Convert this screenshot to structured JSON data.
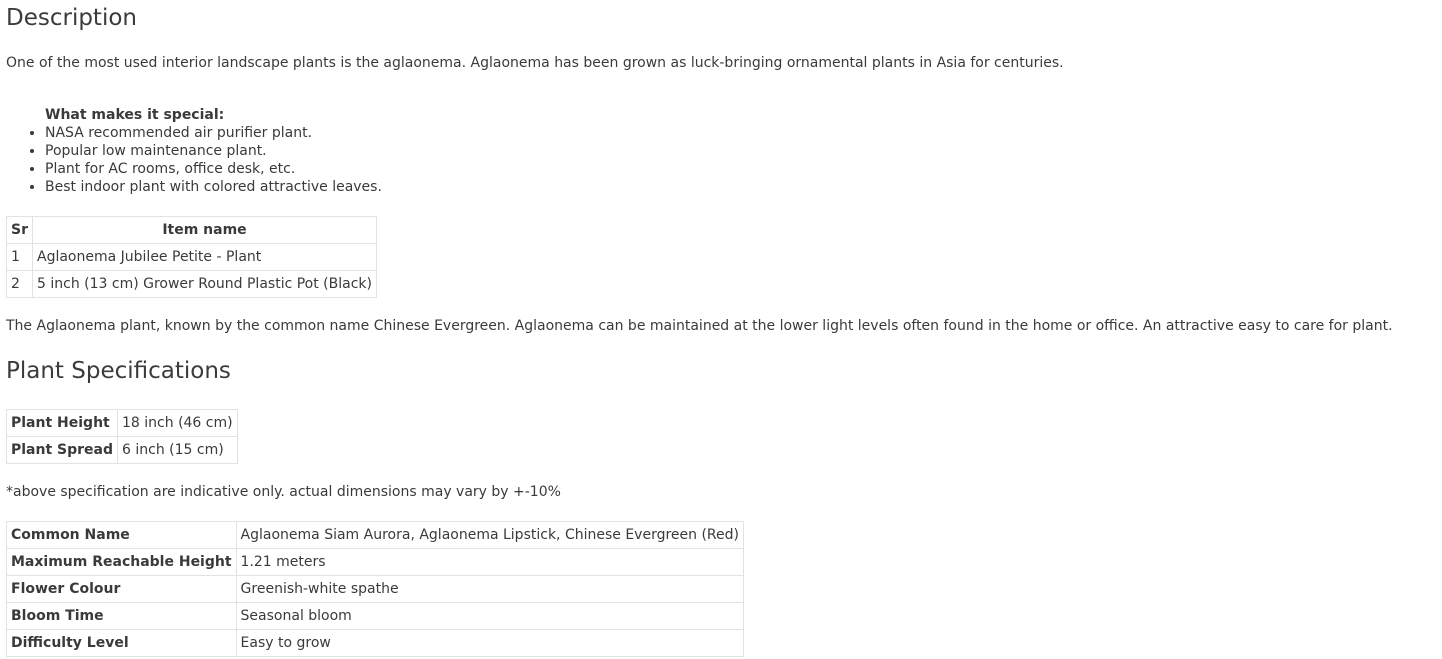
{
  "description": {
    "heading": "Description",
    "intro": "One of the most used interior landscape plants is the aglaonema. Aglaonema has been grown as luck-bringing ornamental plants in Asia for centuries.",
    "special_title": "What makes it special:",
    "features": [
      "NASA recommended air purifier plant.",
      "Popular low maintenance plant.",
      "Plant for AC rooms, office desk, etc.",
      "Best indoor plant with colored attractive leaves."
    ]
  },
  "items_table": {
    "headers": [
      "Sr",
      "Item name"
    ],
    "rows": [
      [
        "1",
        "Aglaonema Jubilee Petite - Plant"
      ],
      [
        "2",
        "5 inch (13 cm) Grower Round Plastic Pot (Black)"
      ]
    ]
  },
  "note_paragraph": "The Aglaonema plant, known by the common name Chinese Evergreen. Aglaonema can be maintained at the lower light levels often found in the home or office. An attractive easy to care for plant.",
  "specifications": {
    "heading": "Plant Specifications",
    "dimensions": [
      [
        "Plant Height",
        "18 inch (46 cm)"
      ],
      [
        "Plant Spread",
        "6 inch (15 cm)"
      ]
    ],
    "disclaimer": "*above specification are indicative only. actual dimensions may vary by +-10%",
    "details": [
      [
        "Common Name",
        "Aglaonema Siam Aurora, Aglaonema Lipstick, Chinese Evergreen (Red)"
      ],
      [
        "Maximum Reachable Height",
        "1.21 meters"
      ],
      [
        "Flower Colour",
        "Greenish-white spathe"
      ],
      [
        "Bloom Time",
        "Seasonal bloom"
      ],
      [
        "Difficulty Level",
        "Easy to grow"
      ]
    ]
  }
}
